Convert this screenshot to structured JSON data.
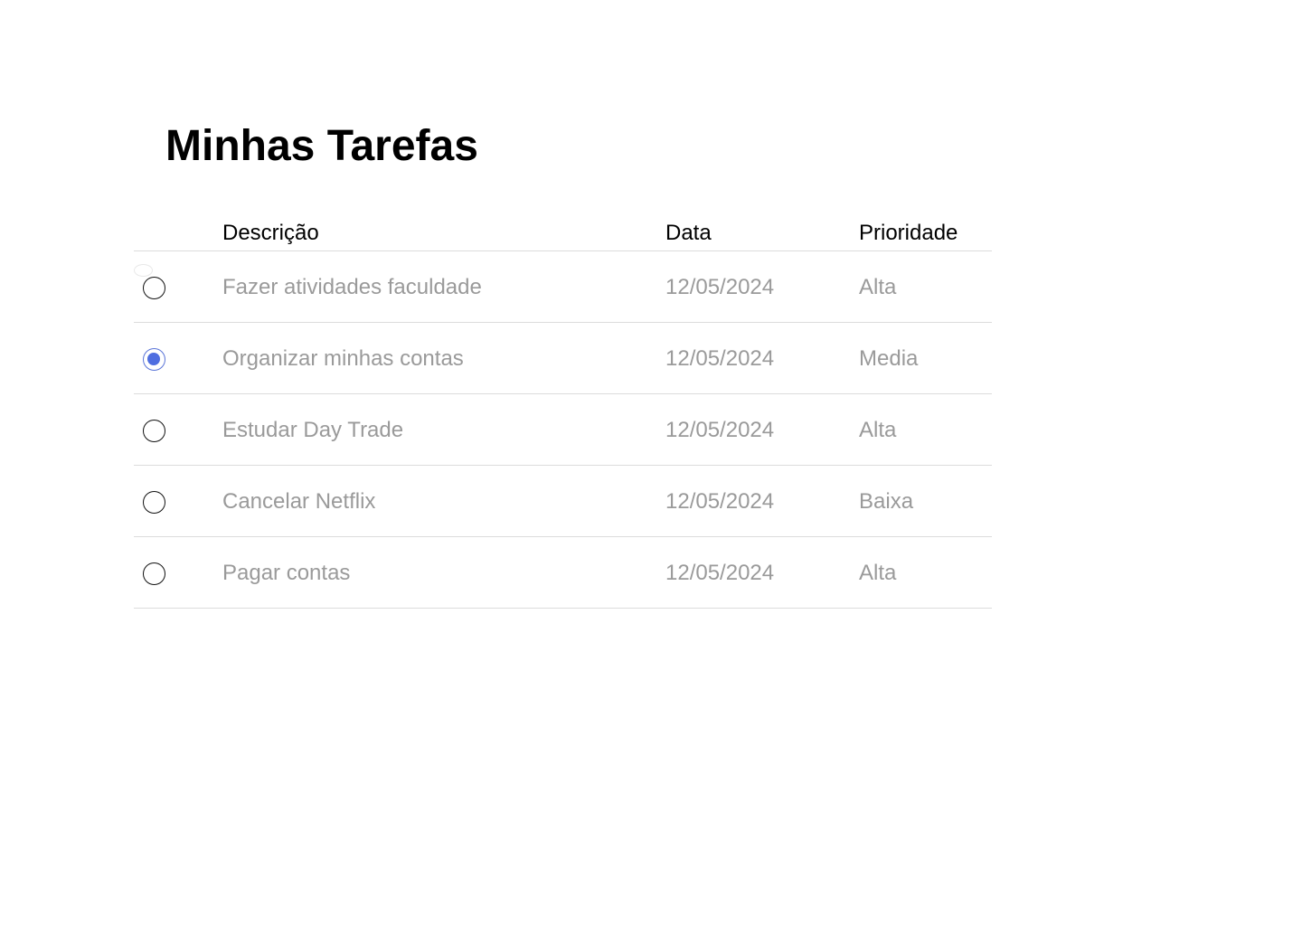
{
  "page": {
    "title": "Minhas Tarefas"
  },
  "table": {
    "headers": {
      "description": "Descrição",
      "date": "Data",
      "priority": "Prioridade"
    },
    "rows": [
      {
        "description": "Fazer atividades faculdade",
        "date": "12/05/2024",
        "priority": "Alta",
        "selected": false
      },
      {
        "description": "Organizar minhas contas",
        "date": "12/05/2024",
        "priority": "Media",
        "selected": true
      },
      {
        "description": "Estudar Day Trade",
        "date": "12/05/2024",
        "priority": "Alta",
        "selected": false
      },
      {
        "description": "Cancelar Netflix",
        "date": "12/05/2024",
        "priority": "Baixa",
        "selected": false
      },
      {
        "description": "Pagar contas",
        "date": "12/05/2024",
        "priority": "Alta",
        "selected": false
      }
    ]
  },
  "colors": {
    "accent": "#4f6ee0",
    "muted_text": "#9a9a9a",
    "divider": "#dcdcdc"
  }
}
